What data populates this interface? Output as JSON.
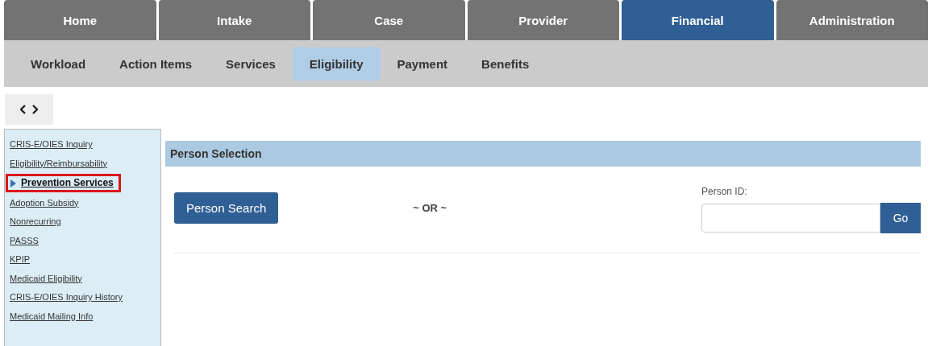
{
  "main_nav": [
    {
      "label": "Home",
      "selected": false
    },
    {
      "label": "Intake",
      "selected": false
    },
    {
      "label": "Case",
      "selected": false
    },
    {
      "label": "Provider",
      "selected": false
    },
    {
      "label": "Financial",
      "selected": true
    },
    {
      "label": "Administration",
      "selected": false
    }
  ],
  "sub_nav": [
    {
      "label": "Workload",
      "selected": false
    },
    {
      "label": "Action Items",
      "selected": false
    },
    {
      "label": "Services",
      "selected": false
    },
    {
      "label": "Eligibility",
      "selected": true
    },
    {
      "label": "Payment",
      "selected": false
    },
    {
      "label": "Benefits",
      "selected": false
    }
  ],
  "sidebar": {
    "items": [
      {
        "label": "CRIS-E/OIES Inquiry",
        "selected": false
      },
      {
        "label": "Eligibility/Reimbursability",
        "selected": false
      },
      {
        "label": "Prevention Services",
        "selected": true
      },
      {
        "label": "Adoption Subsidy",
        "selected": false
      },
      {
        "label": "Nonrecurring",
        "selected": false
      },
      {
        "label": "PASSS",
        "selected": false
      },
      {
        "label": "KPIP",
        "selected": false
      },
      {
        "label": "Medicaid Eligibility",
        "selected": false
      },
      {
        "label": "CRIS-E/OIES Inquiry History",
        "selected": false
      },
      {
        "label": "Medicaid Mailing Info",
        "selected": false
      }
    ]
  },
  "panel": {
    "title": "Person Selection",
    "search_button": "Person Search",
    "separator": "~ OR ~",
    "id_label": "Person ID:",
    "go_button": "Go"
  }
}
